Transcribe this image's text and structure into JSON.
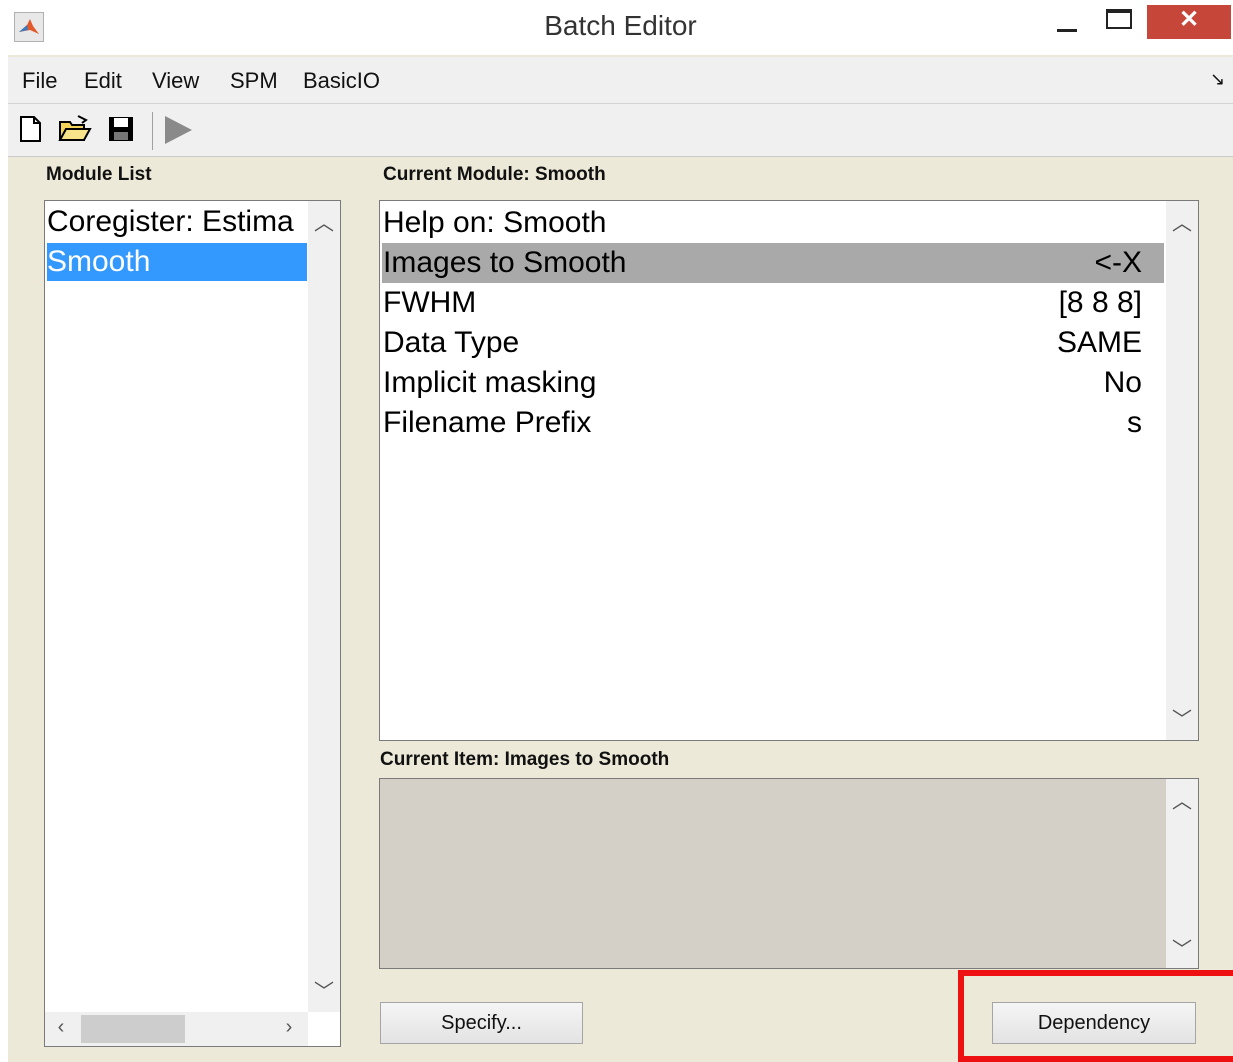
{
  "window": {
    "title": "Batch Editor",
    "close_glyph": "✕"
  },
  "menu": {
    "items": [
      "File",
      "Edit",
      "View",
      "SPM",
      "BasicIO"
    ],
    "overflow_glyph": "↘"
  },
  "toolbar": {
    "icons": [
      "new-file-icon",
      "open-folder-icon",
      "save-icon",
      "run-icon"
    ]
  },
  "module_list": {
    "label": "Module List",
    "items": [
      {
        "label": "Coregister: Estima",
        "selected": false
      },
      {
        "label": "Smooth",
        "selected": true
      }
    ]
  },
  "current_module": {
    "label": "Current Module: Smooth",
    "rows": [
      {
        "label": "Help on: Smooth",
        "value": "",
        "selected": false
      },
      {
        "label": "Images to Smooth",
        "value": "<-X",
        "selected": true
      },
      {
        "label": "FWHM",
        "value": "[8 8 8]",
        "selected": false
      },
      {
        "label": "Data Type",
        "value": "SAME",
        "selected": false
      },
      {
        "label": "Implicit masking",
        "value": "No",
        "selected": false
      },
      {
        "label": "Filename Prefix",
        "value": "s",
        "selected": false
      }
    ]
  },
  "current_item": {
    "label": "Current Item: Images to Smooth"
  },
  "buttons": {
    "specify": "Specify...",
    "dependency": "Dependency"
  },
  "colors": {
    "selection_blue": "#3399ff",
    "selection_gray": "#a9a9a9",
    "highlight_red": "#ee1111",
    "panel_bg": "#ece9d8"
  }
}
